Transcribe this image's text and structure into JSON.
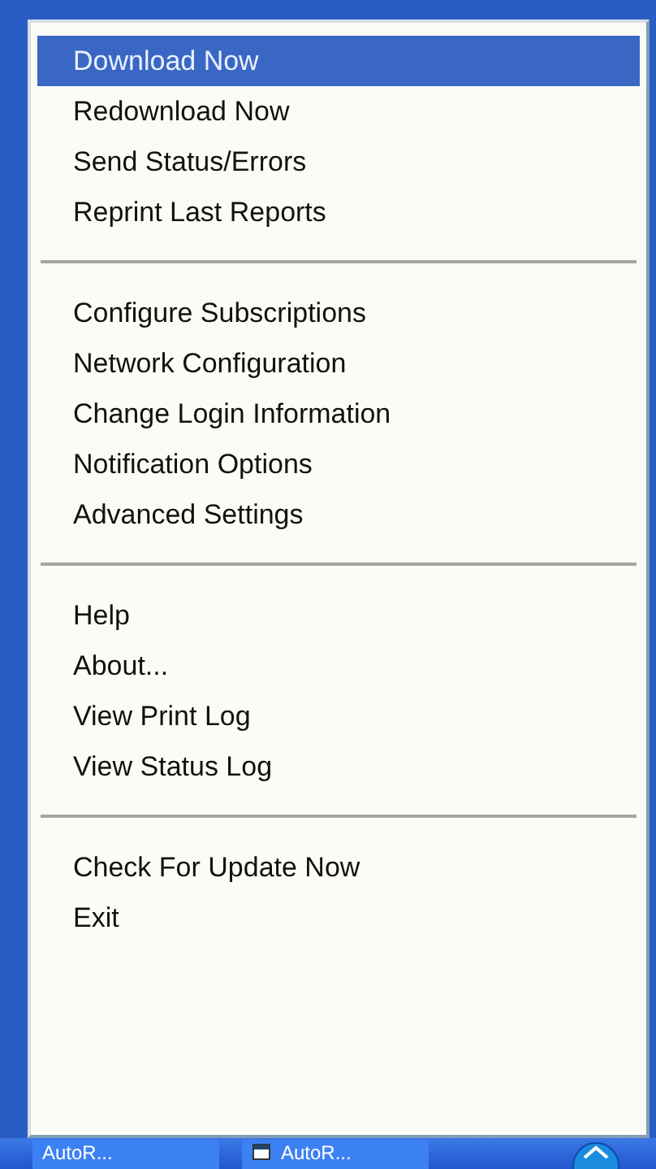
{
  "menu": {
    "sections": [
      {
        "items": [
          {
            "label": "Download Now",
            "selected": true
          },
          {
            "label": "Redownload Now",
            "selected": false
          },
          {
            "label": "Send Status/Errors",
            "selected": false
          },
          {
            "label": "Reprint Last Reports",
            "selected": false
          }
        ]
      },
      {
        "items": [
          {
            "label": "Configure Subscriptions",
            "selected": false
          },
          {
            "label": "Network Configuration",
            "selected": false
          },
          {
            "label": "Change Login Information",
            "selected": false
          },
          {
            "label": "Notification Options",
            "selected": false
          },
          {
            "label": "Advanced Settings",
            "selected": false
          }
        ]
      },
      {
        "items": [
          {
            "label": "Help",
            "selected": false
          },
          {
            "label": "About...",
            "selected": false
          },
          {
            "label": "View Print Log",
            "selected": false
          },
          {
            "label": "View Status Log",
            "selected": false
          }
        ]
      },
      {
        "items": [
          {
            "label": "Check For Update Now",
            "selected": false
          },
          {
            "label": "Exit",
            "selected": false
          }
        ]
      }
    ]
  },
  "taskbar": {
    "buttons": [
      {
        "label": "AutoR..."
      },
      {
        "label": "AutoR..."
      }
    ]
  }
}
